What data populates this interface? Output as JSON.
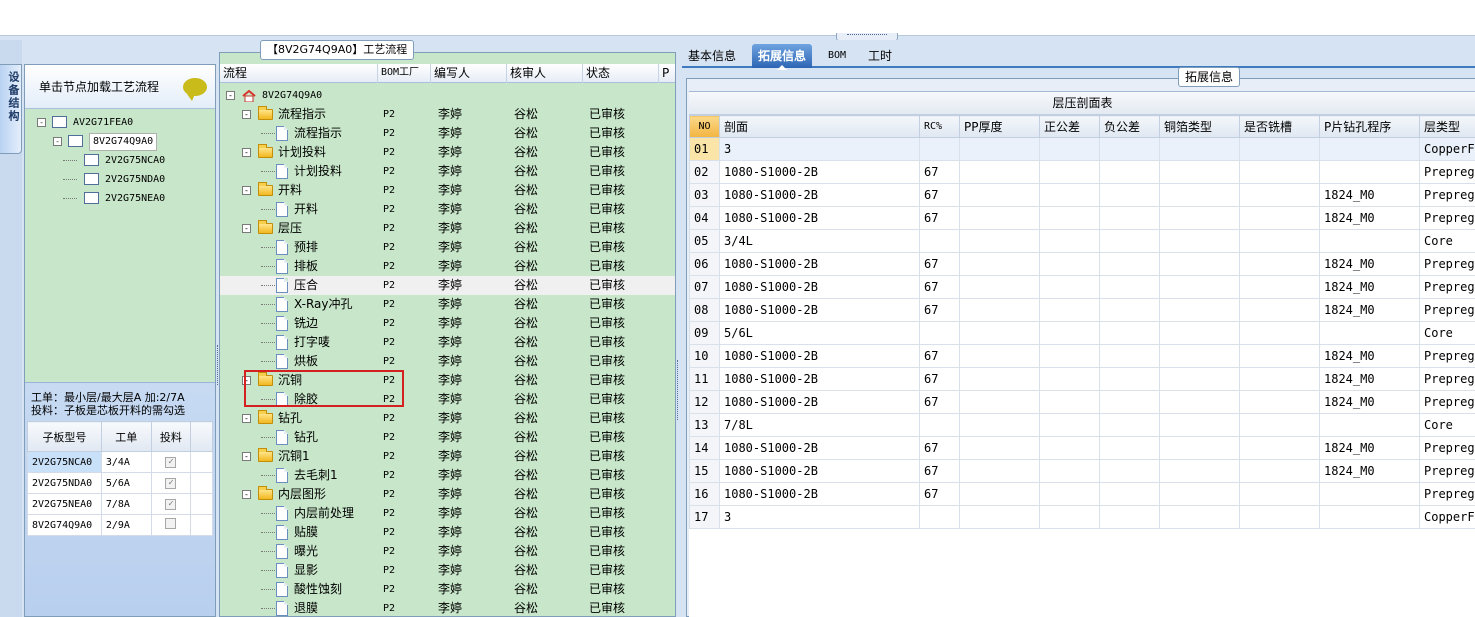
{
  "left_tab": "设备结构",
  "left_panel": {
    "header": "单击节点加载工艺流程",
    "tree": [
      {
        "label": "AV2G71FEA0",
        "level": 0,
        "expanded": true
      },
      {
        "label": "8V2G74Q9A0",
        "level": 1,
        "expanded": true,
        "selected": true
      },
      {
        "label": "2V2G75NCA0",
        "level": 2
      },
      {
        "label": "2V2G75NDA0",
        "level": 2
      },
      {
        "label": "2V2G75NEA0",
        "level": 2
      }
    ],
    "info_line1": "工单：最小层/最大层A 加:2/7A",
    "info_line2": "投料：子板是芯板开料的需勾选",
    "sub_table": {
      "headers": [
        "子板型号",
        "工单",
        "投料"
      ],
      "rows": [
        {
          "model": "2V2G75NCA0",
          "order": "3/4A",
          "feed": true
        },
        {
          "model": "2V2G75NDA0",
          "order": "5/6A",
          "feed": true
        },
        {
          "model": "2V2G75NEA0",
          "order": "7/8A",
          "feed": true
        },
        {
          "model": "8V2G74Q9A0",
          "order": "2/9A",
          "feed": false
        }
      ]
    }
  },
  "middle_panel": {
    "title": "【8V2G74Q9A0】工艺流程",
    "headers": [
      "流程",
      "BOM工厂",
      "编写人",
      "核审人",
      "状态",
      "P"
    ],
    "root": "8V2G74Q9A0",
    "rows": [
      {
        "name": "流程指示",
        "kind": "folder",
        "factory": "P2",
        "writer": "李婷",
        "reviewer": "谷松",
        "status": "已审核"
      },
      {
        "name": "流程指示",
        "kind": "doc",
        "factory": "P2",
        "writer": "李婷",
        "reviewer": "谷松",
        "status": "已审核"
      },
      {
        "name": "计划投料",
        "kind": "folder",
        "factory": "P2",
        "writer": "李婷",
        "reviewer": "谷松",
        "status": "已审核"
      },
      {
        "name": "计划投料",
        "kind": "doc",
        "factory": "P2",
        "writer": "李婷",
        "reviewer": "谷松",
        "status": "已审核"
      },
      {
        "name": "开料",
        "kind": "folder",
        "factory": "P2",
        "writer": "李婷",
        "reviewer": "谷松",
        "status": "已审核"
      },
      {
        "name": "开料",
        "kind": "doc",
        "factory": "P2",
        "writer": "李婷",
        "reviewer": "谷松",
        "status": "已审核"
      },
      {
        "name": "层压",
        "kind": "folder",
        "factory": "P2",
        "writer": "李婷",
        "reviewer": "谷松",
        "status": "已审核"
      },
      {
        "name": "预排",
        "kind": "doc",
        "factory": "P2",
        "writer": "李婷",
        "reviewer": "谷松",
        "status": "已审核"
      },
      {
        "name": "排板",
        "kind": "doc",
        "factory": "P2",
        "writer": "李婷",
        "reviewer": "谷松",
        "status": "已审核"
      },
      {
        "name": "压合",
        "kind": "doc",
        "factory": "P2",
        "writer": "李婷",
        "reviewer": "谷松",
        "status": "已审核",
        "selected": true
      },
      {
        "name": "X-Ray冲孔",
        "kind": "doc",
        "factory": "P2",
        "writer": "李婷",
        "reviewer": "谷松",
        "status": "已审核"
      },
      {
        "name": "铣边",
        "kind": "doc",
        "factory": "P2",
        "writer": "李婷",
        "reviewer": "谷松",
        "status": "已审核"
      },
      {
        "name": "打字唛",
        "kind": "doc",
        "factory": "P2",
        "writer": "李婷",
        "reviewer": "谷松",
        "status": "已审核"
      },
      {
        "name": "烘板",
        "kind": "doc",
        "factory": "P2",
        "writer": "李婷",
        "reviewer": "谷松",
        "status": "已审核"
      },
      {
        "name": "沉铜",
        "kind": "folder",
        "factory": "P2",
        "writer": "李婷",
        "reviewer": "谷松",
        "status": "已审核"
      },
      {
        "name": "除胶",
        "kind": "doc",
        "factory": "P2",
        "writer": "李婷",
        "reviewer": "谷松",
        "status": "已审核"
      },
      {
        "name": "钻孔",
        "kind": "folder",
        "factory": "P2",
        "writer": "李婷",
        "reviewer": "谷松",
        "status": "已审核"
      },
      {
        "name": "钻孔",
        "kind": "doc",
        "factory": "P2",
        "writer": "李婷",
        "reviewer": "谷松",
        "status": "已审核"
      },
      {
        "name": "沉铜1",
        "kind": "folder",
        "factory": "P2",
        "writer": "李婷",
        "reviewer": "谷松",
        "status": "已审核"
      },
      {
        "name": "去毛刺1",
        "kind": "doc",
        "factory": "P2",
        "writer": "李婷",
        "reviewer": "谷松",
        "status": "已审核"
      },
      {
        "name": "内层图形",
        "kind": "folder",
        "factory": "P2",
        "writer": "李婷",
        "reviewer": "谷松",
        "status": "已审核"
      },
      {
        "name": "内层前处理",
        "kind": "doc",
        "factory": "P2",
        "writer": "李婷",
        "reviewer": "谷松",
        "status": "已审核"
      },
      {
        "name": "贴膜",
        "kind": "doc",
        "factory": "P2",
        "writer": "李婷",
        "reviewer": "谷松",
        "status": "已审核"
      },
      {
        "name": "曝光",
        "kind": "doc",
        "factory": "P2",
        "writer": "李婷",
        "reviewer": "谷松",
        "status": "已审核"
      },
      {
        "name": "显影",
        "kind": "doc",
        "factory": "P2",
        "writer": "李婷",
        "reviewer": "谷松",
        "status": "已审核"
      },
      {
        "name": "酸性蚀刻",
        "kind": "doc",
        "factory": "P2",
        "writer": "李婷",
        "reviewer": "谷松",
        "status": "已审核"
      },
      {
        "name": "退膜",
        "kind": "doc",
        "factory": "P2",
        "writer": "李婷",
        "reviewer": "谷松",
        "status": "已审核"
      }
    ]
  },
  "right_panel": {
    "tabs": [
      "基本信息",
      "拓展信息",
      "BOM",
      "工时"
    ],
    "active_tab": "拓展信息",
    "group_title": "拓展信息",
    "table_caption": "层压剖面表",
    "headers": [
      "NO",
      "剖面",
      "RC%",
      "PP厚度",
      "正公差",
      "负公差",
      "铜箔类型",
      "是否铣槽",
      "P片钻孔程序",
      "层类型"
    ],
    "rows": [
      [
        "01",
        "3",
        "",
        "",
        "",
        "",
        "",
        "",
        "",
        "CopperFo"
      ],
      [
        "02",
        "1080-S1000-2B",
        "67",
        "",
        "",
        "",
        "",
        "",
        "",
        "Prepreg"
      ],
      [
        "03",
        "1080-S1000-2B",
        "67",
        "",
        "",
        "",
        "",
        "",
        "1824_M0",
        "Prepreg"
      ],
      [
        "04",
        "1080-S1000-2B",
        "67",
        "",
        "",
        "",
        "",
        "",
        "1824_M0",
        "Prepreg"
      ],
      [
        "05",
        "3/4L",
        "",
        "",
        "",
        "",
        "",
        "",
        "",
        "Core"
      ],
      [
        "06",
        "1080-S1000-2B",
        "67",
        "",
        "",
        "",
        "",
        "",
        "1824_M0",
        "Prepreg"
      ],
      [
        "07",
        "1080-S1000-2B",
        "67",
        "",
        "",
        "",
        "",
        "",
        "1824_M0",
        "Prepreg"
      ],
      [
        "08",
        "1080-S1000-2B",
        "67",
        "",
        "",
        "",
        "",
        "",
        "1824_M0",
        "Prepreg"
      ],
      [
        "09",
        "5/6L",
        "",
        "",
        "",
        "",
        "",
        "",
        "",
        "Core"
      ],
      [
        "10",
        "1080-S1000-2B",
        "67",
        "",
        "",
        "",
        "",
        "",
        "1824_M0",
        "Prepreg"
      ],
      [
        "11",
        "1080-S1000-2B",
        "67",
        "",
        "",
        "",
        "",
        "",
        "1824_M0",
        "Prepreg"
      ],
      [
        "12",
        "1080-S1000-2B",
        "67",
        "",
        "",
        "",
        "",
        "",
        "1824_M0",
        "Prepreg"
      ],
      [
        "13",
        "7/8L",
        "",
        "",
        "",
        "",
        "",
        "",
        "",
        "Core"
      ],
      [
        "14",
        "1080-S1000-2B",
        "67",
        "",
        "",
        "",
        "",
        "",
        "1824_M0",
        "Prepreg"
      ],
      [
        "15",
        "1080-S1000-2B",
        "67",
        "",
        "",
        "",
        "",
        "",
        "1824_M0",
        "Prepreg"
      ],
      [
        "16",
        "1080-S1000-2B",
        "67",
        "",
        "",
        "",
        "",
        "",
        "",
        "Prepreg"
      ],
      [
        "17",
        "3",
        "",
        "",
        "",
        "",
        "",
        "",
        "",
        "CopperFo"
      ]
    ]
  },
  "colors": {
    "tree_background": "#c8e6c9",
    "active_tab": "#2c65b4",
    "highlight_box": "#d42020",
    "row_number_header": "#f2b440"
  }
}
